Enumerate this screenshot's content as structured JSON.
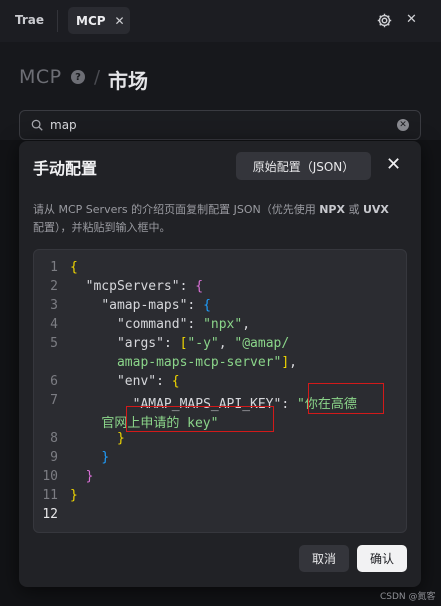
{
  "tabs": {
    "trae_label": "Trae",
    "mcp_label": "MCP"
  },
  "page": {
    "crumb_mcp": "MCP",
    "crumb_market": "市场"
  },
  "search": {
    "value": "map"
  },
  "modal": {
    "title": "手动配置",
    "raw_config_label": "原始配置（JSON）",
    "desc_part1": "请从 MCP Servers 的介绍页面复制配置 JSON（优先使用 ",
    "desc_npx": "NPX",
    "desc_or": " 或 ",
    "desc_uvx": "UVX",
    "desc_part2": "配置），并粘贴到输入框中。",
    "cancel_label": "取消",
    "confirm_label": "确认"
  },
  "code": {
    "line_numbers": [
      "1",
      "2",
      "3",
      "4",
      "5",
      "6",
      "7",
      "8",
      "9",
      "10",
      "11",
      "12"
    ],
    "key_mcpServers": "\"mcpServers\"",
    "key_amap": "\"amap-maps\"",
    "key_command": "\"command\"",
    "val_command": "\"npx\"",
    "key_args": "\"args\"",
    "val_args_1": "\"-y\"",
    "val_args_2a": "\"@amap/",
    "val_args_2b": "amap-maps-mcp-server\"",
    "key_env": "\"env\"",
    "key_api": "\"AMAP_MAPS_API_KEY\"",
    "val_api_a": "\"你在高德",
    "val_api_b": "官网上申请的 key\""
  },
  "watermark": "CSDN @氮客"
}
